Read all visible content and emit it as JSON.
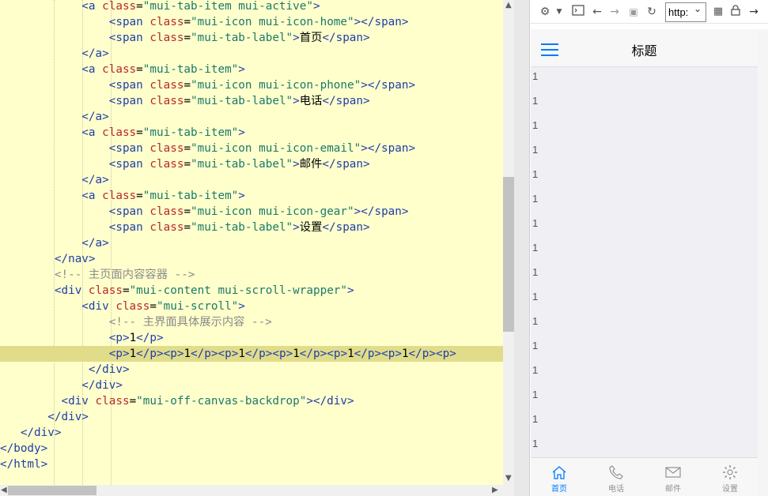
{
  "editor": {
    "lines": [
      {
        "tokens": [
          [
            "p",
            "            "
          ],
          [
            "t",
            "<a "
          ],
          [
            "a",
            "class"
          ],
          [
            "p",
            "="
          ],
          [
            "s",
            "\"mui-tab-item mui-active\""
          ],
          [
            "t",
            ">"
          ]
        ]
      },
      {
        "tokens": [
          [
            "p",
            "                "
          ],
          [
            "t",
            "<span "
          ],
          [
            "a",
            "class"
          ],
          [
            "p",
            "="
          ],
          [
            "s",
            "\"mui-icon mui-icon-home\""
          ],
          [
            "t",
            "></span>"
          ]
        ]
      },
      {
        "tokens": [
          [
            "p",
            "                "
          ],
          [
            "t",
            "<span "
          ],
          [
            "a",
            "class"
          ],
          [
            "p",
            "="
          ],
          [
            "s",
            "\"mui-tab-label\""
          ],
          [
            "t",
            ">"
          ],
          [
            "p",
            "首页"
          ],
          [
            "t",
            "</span>"
          ]
        ]
      },
      {
        "tokens": [
          [
            "p",
            "            "
          ],
          [
            "t",
            "</a>"
          ]
        ]
      },
      {
        "tokens": [
          [
            "p",
            "            "
          ],
          [
            "t",
            "<a "
          ],
          [
            "a",
            "class"
          ],
          [
            "p",
            "="
          ],
          [
            "s",
            "\"mui-tab-item\""
          ],
          [
            "t",
            ">"
          ]
        ]
      },
      {
        "tokens": [
          [
            "p",
            "                "
          ],
          [
            "t",
            "<span "
          ],
          [
            "a",
            "class"
          ],
          [
            "p",
            "="
          ],
          [
            "s",
            "\"mui-icon mui-icon-phone\""
          ],
          [
            "t",
            "></span>"
          ]
        ]
      },
      {
        "tokens": [
          [
            "p",
            "                "
          ],
          [
            "t",
            "<span "
          ],
          [
            "a",
            "class"
          ],
          [
            "p",
            "="
          ],
          [
            "s",
            "\"mui-tab-label\""
          ],
          [
            "t",
            ">"
          ],
          [
            "p",
            "电话"
          ],
          [
            "t",
            "</span>"
          ]
        ]
      },
      {
        "tokens": [
          [
            "p",
            "            "
          ],
          [
            "t",
            "</a>"
          ]
        ]
      },
      {
        "tokens": [
          [
            "p",
            "            "
          ],
          [
            "t",
            "<a "
          ],
          [
            "a",
            "class"
          ],
          [
            "p",
            "="
          ],
          [
            "s",
            "\"mui-tab-item\""
          ],
          [
            "t",
            ">"
          ]
        ]
      },
      {
        "tokens": [
          [
            "p",
            "                "
          ],
          [
            "t",
            "<span "
          ],
          [
            "a",
            "class"
          ],
          [
            "p",
            "="
          ],
          [
            "s",
            "\"mui-icon mui-icon-email\""
          ],
          [
            "t",
            "></span>"
          ]
        ]
      },
      {
        "tokens": [
          [
            "p",
            "                "
          ],
          [
            "t",
            "<span "
          ],
          [
            "a",
            "class"
          ],
          [
            "p",
            "="
          ],
          [
            "s",
            "\"mui-tab-label\""
          ],
          [
            "t",
            ">"
          ],
          [
            "p",
            "邮件"
          ],
          [
            "t",
            "</span>"
          ]
        ]
      },
      {
        "tokens": [
          [
            "p",
            "            "
          ],
          [
            "t",
            "</a>"
          ]
        ]
      },
      {
        "tokens": [
          [
            "p",
            "            "
          ],
          [
            "t",
            "<a "
          ],
          [
            "a",
            "class"
          ],
          [
            "p",
            "="
          ],
          [
            "s",
            "\"mui-tab-item\""
          ],
          [
            "t",
            ">"
          ]
        ]
      },
      {
        "tokens": [
          [
            "p",
            "                "
          ],
          [
            "t",
            "<span "
          ],
          [
            "a",
            "class"
          ],
          [
            "p",
            "="
          ],
          [
            "s",
            "\"mui-icon mui-icon-gear\""
          ],
          [
            "t",
            "></span>"
          ]
        ]
      },
      {
        "tokens": [
          [
            "p",
            "                "
          ],
          [
            "t",
            "<span "
          ],
          [
            "a",
            "class"
          ],
          [
            "p",
            "="
          ],
          [
            "s",
            "\"mui-tab-label\""
          ],
          [
            "t",
            ">"
          ],
          [
            "p",
            "设置"
          ],
          [
            "t",
            "</span>"
          ]
        ]
      },
      {
        "tokens": [
          [
            "p",
            "            "
          ],
          [
            "t",
            "</a>"
          ]
        ]
      },
      {
        "tokens": [
          [
            "p",
            "        "
          ],
          [
            "t",
            "</nav>"
          ]
        ]
      },
      {
        "tokens": [
          [
            "p",
            "        "
          ],
          [
            "c",
            "<!-- 主页面内容容器 -->"
          ]
        ]
      },
      {
        "tokens": [
          [
            "p",
            "        "
          ],
          [
            "t",
            "<div "
          ],
          [
            "a",
            "class"
          ],
          [
            "p",
            "="
          ],
          [
            "s",
            "\"mui-content mui-scroll-wrapper\""
          ],
          [
            "t",
            ">"
          ]
        ]
      },
      {
        "tokens": [
          [
            "p",
            "            "
          ],
          [
            "t",
            "<div "
          ],
          [
            "a",
            "class"
          ],
          [
            "p",
            "="
          ],
          [
            "s",
            "\"mui-scroll\""
          ],
          [
            "t",
            ">"
          ]
        ]
      },
      {
        "tokens": [
          [
            "p",
            "                "
          ],
          [
            "c",
            "<!-- 主界面具体展示内容 -->"
          ]
        ]
      },
      {
        "tokens": [
          [
            "p",
            "                "
          ],
          [
            "t",
            "<p>"
          ],
          [
            "p",
            "1"
          ],
          [
            "t",
            "</p>"
          ]
        ]
      },
      {
        "tokens": [
          [
            "p",
            "                "
          ],
          [
            "t",
            "<p>"
          ],
          [
            "p",
            "1"
          ],
          [
            "t",
            "</p><p>"
          ],
          [
            "p",
            "1"
          ],
          [
            "t",
            "</p><p>"
          ],
          [
            "p",
            "1"
          ],
          [
            "t",
            "</p><p>"
          ],
          [
            "p",
            "1"
          ],
          [
            "t",
            "</p><p>"
          ],
          [
            "p",
            "1"
          ],
          [
            "t",
            "</p><p>"
          ],
          [
            "p",
            "1"
          ],
          [
            "t",
            "</p><p>"
          ]
        ]
      },
      {
        "tokens": [
          [
            "p",
            "             "
          ],
          [
            "t",
            "</div>"
          ]
        ]
      },
      {
        "tokens": [
          [
            "p",
            "            "
          ],
          [
            "t",
            "</div>"
          ]
        ]
      },
      {
        "tokens": [
          [
            "p",
            "         "
          ],
          [
            "t",
            "<div "
          ],
          [
            "a",
            "class"
          ],
          [
            "p",
            "="
          ],
          [
            "s",
            "\"mui-off-canvas-backdrop\""
          ],
          [
            "t",
            "></div>"
          ]
        ]
      },
      {
        "tokens": [
          [
            "p",
            "       "
          ],
          [
            "t",
            "</div>"
          ]
        ]
      },
      {
        "tokens": [
          [
            "p",
            "   "
          ],
          [
            "t",
            "</div>"
          ]
        ]
      },
      {
        "tokens": [
          [
            "t",
            "</body>"
          ]
        ]
      },
      {
        "tokens": [
          [
            "t",
            "</html>"
          ]
        ]
      }
    ],
    "current_line": 22
  },
  "browser": {
    "url": "http:",
    "icons": [
      "gear-icon",
      "chevron-down-icon",
      "devtools-icon",
      "back-icon",
      "forward-icon",
      "stop-icon",
      "reload-icon",
      "qr-icon",
      "lock-icon",
      "go-icon"
    ]
  },
  "phone": {
    "title": "标题",
    "items": [
      "1",
      "1",
      "1",
      "1",
      "1",
      "1",
      "1",
      "1",
      "1",
      "1",
      "1",
      "1",
      "1",
      "1",
      "1",
      "1"
    ],
    "tabs": [
      {
        "label": "首页",
        "icon": "home-icon",
        "active": true
      },
      {
        "label": "电话",
        "icon": "phone-icon",
        "active": false
      },
      {
        "label": "邮件",
        "icon": "email-icon",
        "active": false
      },
      {
        "label": "设置",
        "icon": "gear-icon",
        "active": false
      }
    ],
    "accent": "#007aff"
  }
}
